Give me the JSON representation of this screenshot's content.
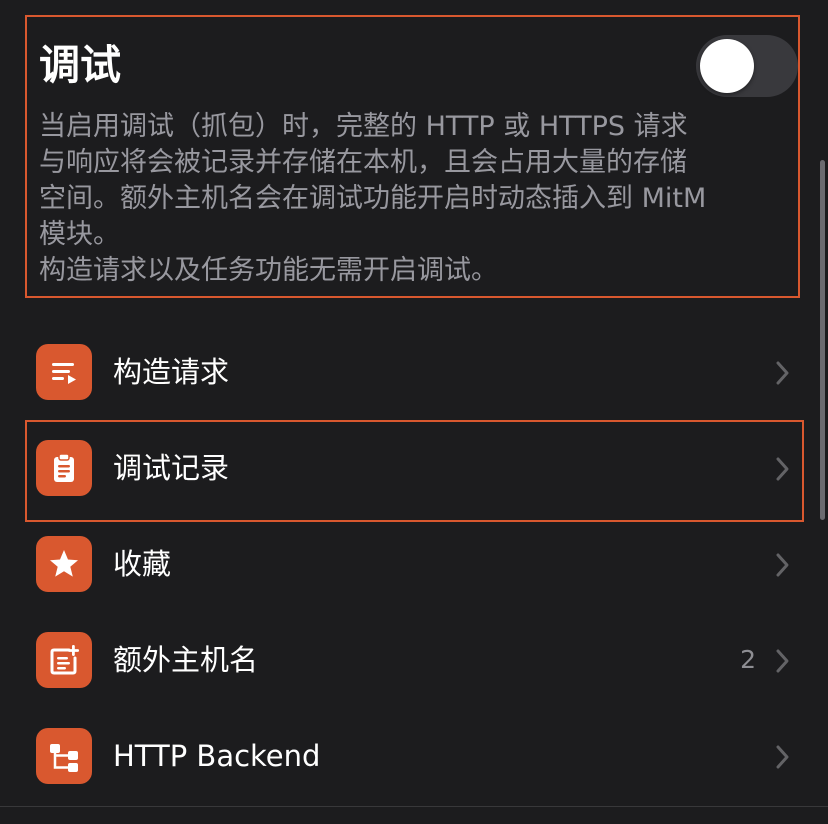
{
  "debug": {
    "title": "调试",
    "toggle_on": false,
    "description": "当启用调试（抓包）时，完整的 HTTP 或 HTTPS 请求\n与响应将会被记录并存储在本机，且会占用大量的存储\n空间。额外主机名会在调试功能开启时动态插入到 MitM\n模块。\n构造请求以及任务功能无需开启调试。"
  },
  "menu": {
    "items": [
      {
        "label": "构造请求",
        "icon": "list-play-icon",
        "badge": ""
      },
      {
        "label": "调试记录",
        "icon": "clipboard-icon",
        "badge": ""
      },
      {
        "label": "收藏",
        "icon": "star-icon",
        "badge": ""
      },
      {
        "label": "额外主机名",
        "icon": "note-add-icon",
        "badge": "2"
      },
      {
        "label": "HTTP Backend",
        "icon": "tree-icon",
        "badge": ""
      }
    ]
  },
  "colors": {
    "accent": "#d9582f",
    "background": "#1c1c1e",
    "secondary_text": "#98989f"
  }
}
